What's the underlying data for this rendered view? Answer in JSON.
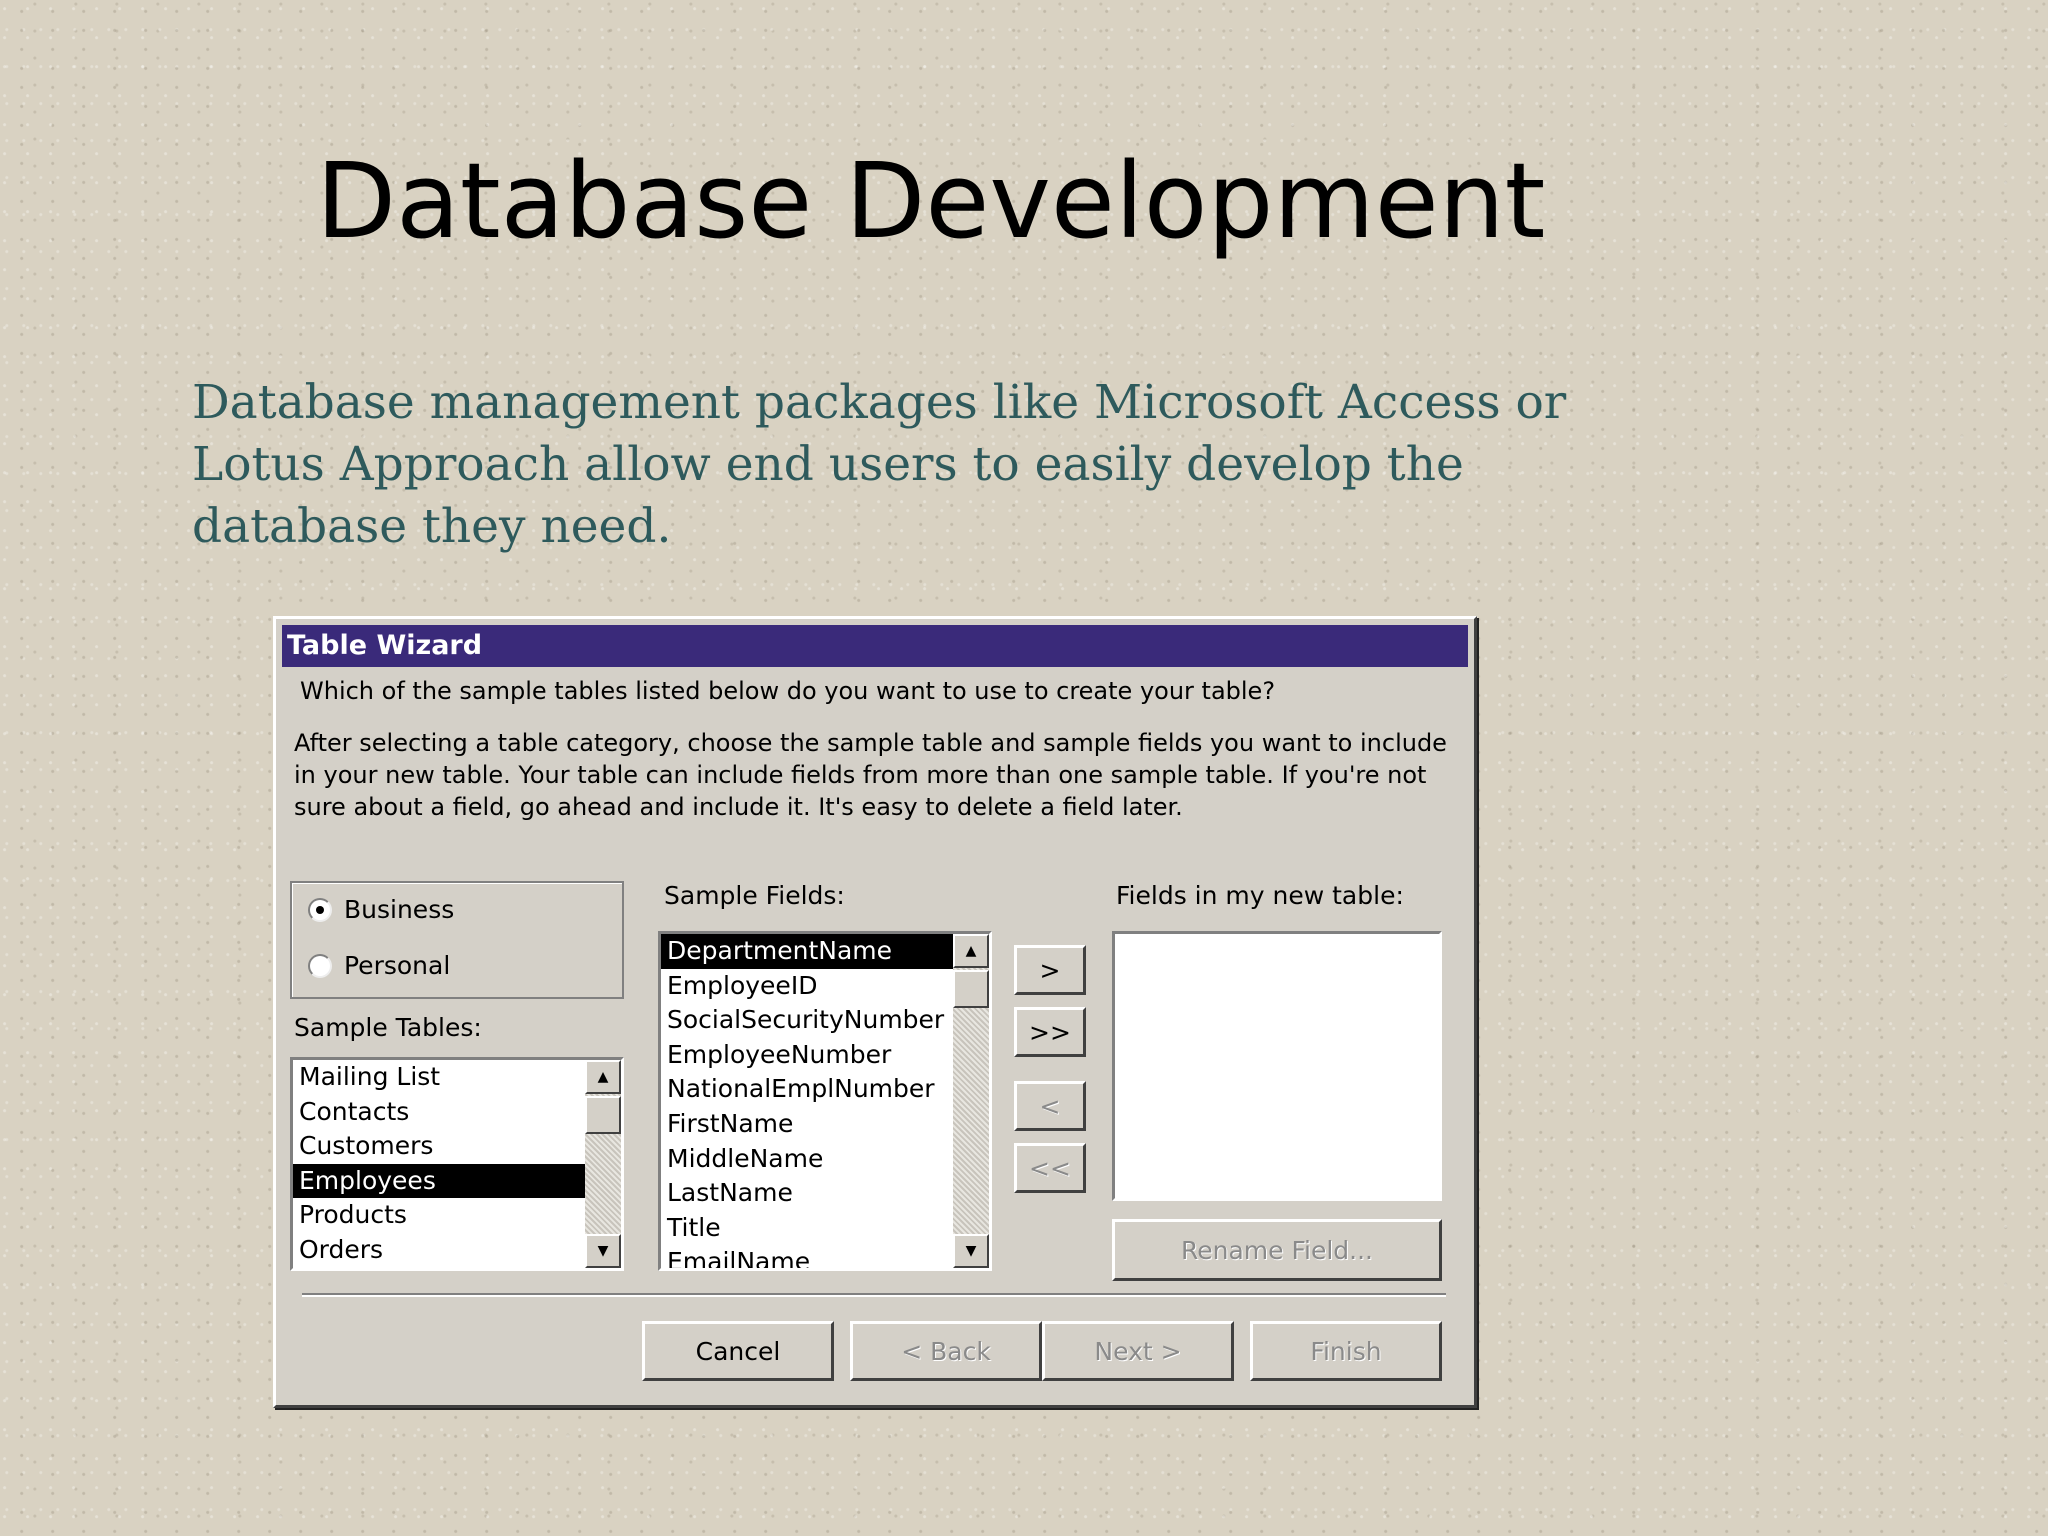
{
  "slide": {
    "title": "Database Development",
    "body": "Database management packages like Microsoft Access or Lotus Approach allow end users to easily develop the database they need."
  },
  "dialog": {
    "title": "Table Wizard",
    "question": "Which of the sample tables listed below do you want to use to create your table?",
    "instructions": "After selecting a table category, choose the sample table and sample fields you want to include in your new table. Your table can include fields from more than one sample table. If you're not sure about a field, go ahead and include it. It's easy to delete a field later.",
    "category": {
      "options": [
        {
          "label": "Business",
          "checked": true
        },
        {
          "label": "Personal",
          "checked": false
        }
      ]
    },
    "sample_tables": {
      "label": "Sample Tables:",
      "items": [
        "Mailing List",
        "Contacts",
        "Customers",
        "Employees",
        "Products",
        "Orders"
      ],
      "selected": "Employees"
    },
    "sample_fields": {
      "label": "Sample Fields:",
      "items": [
        "DepartmentName",
        "EmployeeID",
        "SocialSecurityNumber",
        "EmployeeNumber",
        "NationalEmplNumber",
        "FirstName",
        "MiddleName",
        "LastName",
        "Title",
        "EmailName"
      ],
      "selected": "DepartmentName"
    },
    "move_buttons": {
      "add_one": ">",
      "add_all": ">>",
      "remove_one": "<",
      "remove_all": "<<"
    },
    "new_table": {
      "label": "Fields in my new table:",
      "rename_button": "Rename Field..."
    },
    "footer": {
      "cancel": "Cancel",
      "back": "< Back",
      "next": "Next >",
      "finish": "Finish"
    }
  }
}
